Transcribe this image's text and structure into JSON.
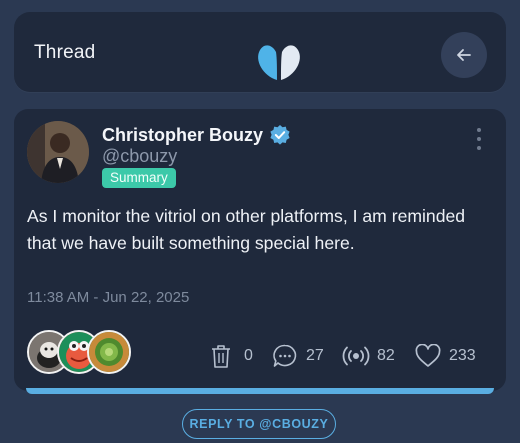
{
  "header": {
    "title": "Thread"
  },
  "post": {
    "author_name": "Christopher Bouzy",
    "author_handle": "@cbouzy",
    "badge": "Summary",
    "text": "As I monitor the vitriol on other platforms, I am reminded that we have built something special here.",
    "timestamp": "11:38 AM - Jun 22, 2025",
    "stats": {
      "delete": "0",
      "comments": "27",
      "reposts": "82",
      "likes": "233"
    }
  },
  "reply_button": {
    "label": "REPLY TO @CBOUZY"
  },
  "colors": {
    "background": "#2b3952",
    "card": "#1f293c",
    "accent": "#5aaee2",
    "badge": "#3cc9a9",
    "verified": "#5aaee2"
  },
  "icons": [
    "logo-icon",
    "back-arrow-icon",
    "verified-icon",
    "more-vertical-icon",
    "trash-icon",
    "comment-icon",
    "broadcast-icon",
    "heart-icon"
  ]
}
